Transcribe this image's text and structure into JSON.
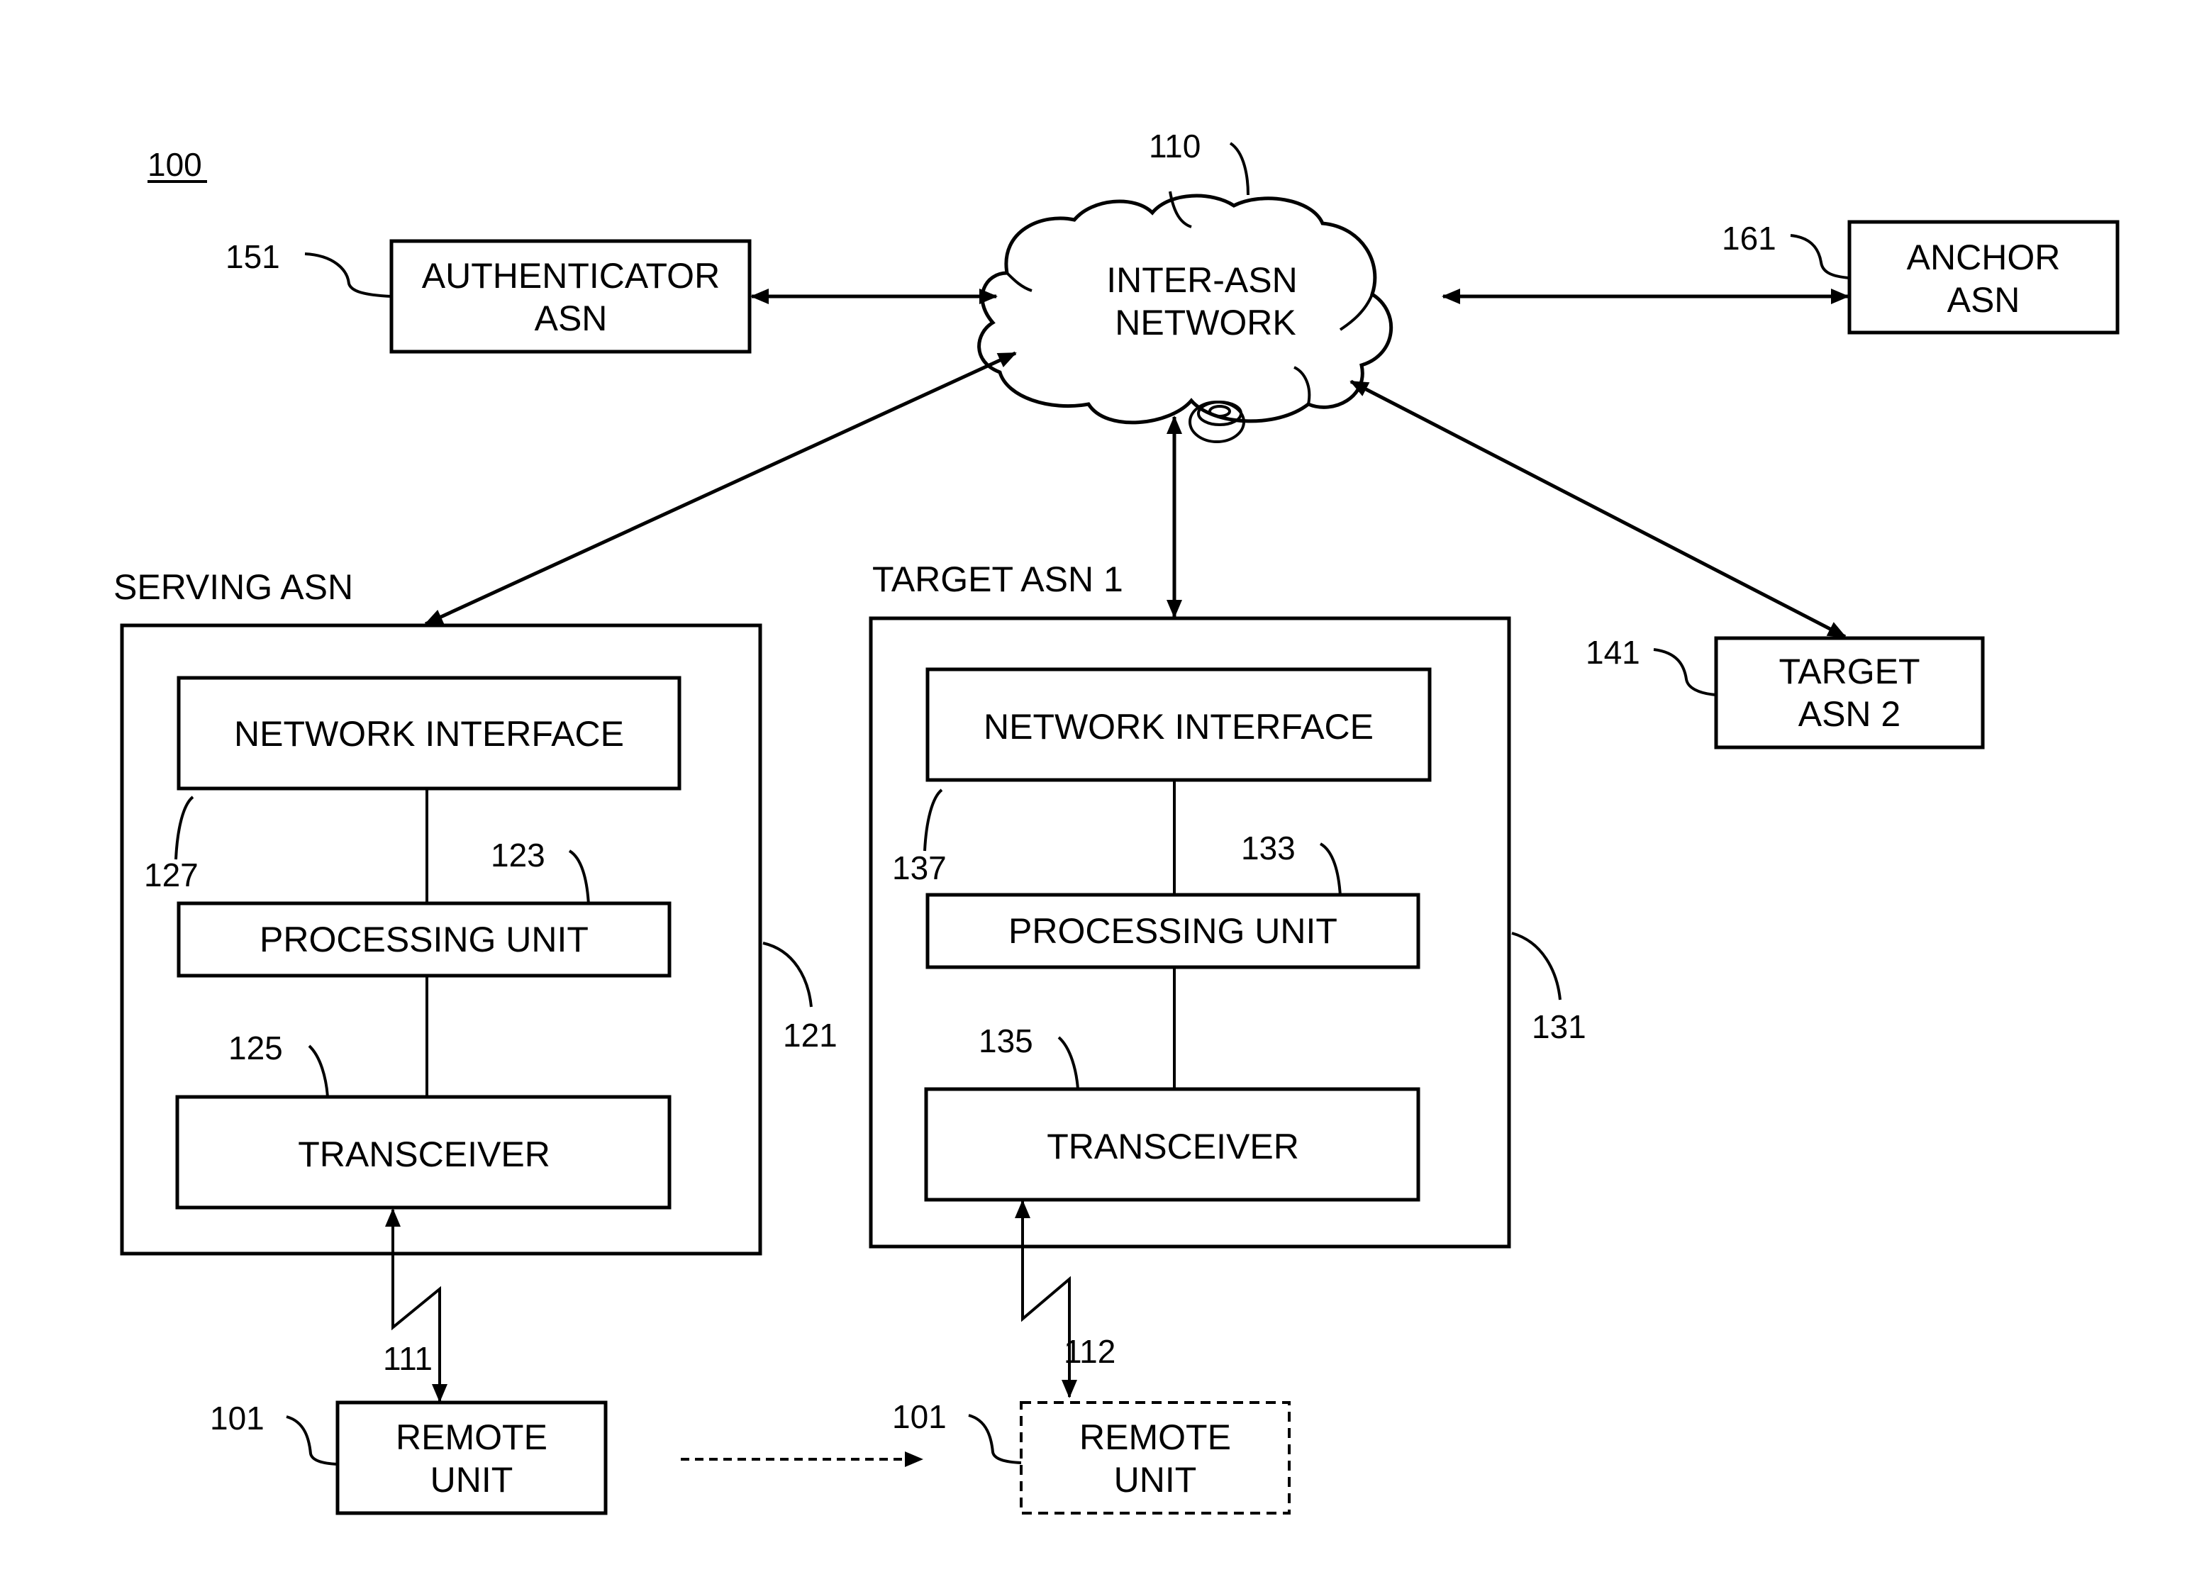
{
  "figure": {
    "ref": "100"
  },
  "network": {
    "ref": "110",
    "line1": "INTER-ASN",
    "line2": "NETWORK"
  },
  "authenticator": {
    "ref": "151",
    "line1": "AUTHENTICATOR",
    "line2": "ASN"
  },
  "anchor": {
    "ref": "161",
    "line1": "ANCHOR",
    "line2": "ASN"
  },
  "target2": {
    "ref": "141",
    "line1": "TARGET",
    "line2": "ASN 2"
  },
  "serving": {
    "title": "SERVING ASN",
    "ref": "121",
    "network_interface": {
      "label": "NETWORK INTERFACE",
      "ref": "127"
    },
    "processing_unit": {
      "label": "PROCESSING UNIT",
      "ref": "123"
    },
    "transceiver": {
      "label": "TRANSCEIVER",
      "ref": "125"
    },
    "link_ref": "111"
  },
  "target1": {
    "title": "TARGET ASN 1",
    "ref": "131",
    "network_interface": {
      "label": "NETWORK INTERFACE",
      "ref": "137"
    },
    "processing_unit": {
      "label": "PROCESSING UNIT",
      "ref": "133"
    },
    "transceiver": {
      "label": "TRANSCEIVER",
      "ref": "135"
    },
    "link_ref": "112"
  },
  "remote_units": [
    {
      "ref": "101",
      "line1": "REMOTE",
      "line2": "UNIT",
      "style": "solid"
    },
    {
      "ref": "101",
      "line1": "REMOTE",
      "line2": "UNIT",
      "style": "dashed"
    }
  ]
}
